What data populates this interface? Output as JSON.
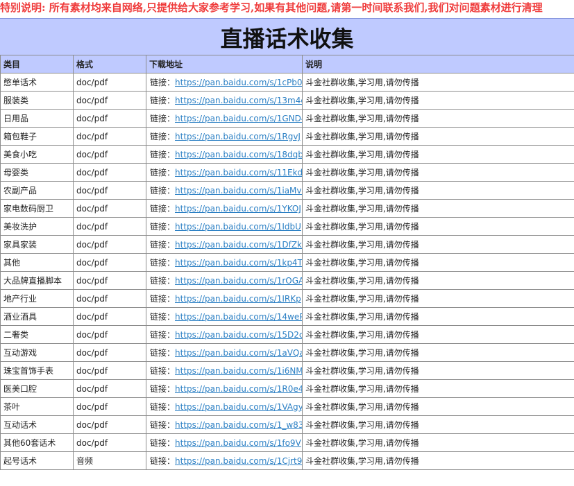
{
  "notice": "特别说明: 所有素材均来自网络,只提供给大家参考学习,如果有其他问题,请第一时间联系我们,我们对问题素材进行清理",
  "title": "直播话术收集",
  "columns": [
    "类目",
    "格式",
    "下载地址",
    "说明"
  ],
  "link_label": "链接：",
  "rows": [
    {
      "category": "憋单话术",
      "format": "doc/pdf",
      "url": "https://pan.baidu.com/s/1cPb0",
      "note": "斗金社群收集,学习用,请勿传播"
    },
    {
      "category": "服装类",
      "format": "doc/pdf",
      "url": "https://pan.baidu.com/s/13m4c",
      "note": "斗金社群收集,学习用,请勿传播"
    },
    {
      "category": "日用品",
      "format": "doc/pdf",
      "url": "https://pan.baidu.com/s/1GND4",
      "note": "斗金社群收集,学习用,请勿传播"
    },
    {
      "category": "箱包鞋子",
      "format": "doc/pdf",
      "url": "https://pan.baidu.com/s/1RgvJ",
      "note": "斗金社群收集,学习用,请勿传播"
    },
    {
      "category": "美食小吃",
      "format": "doc/pdf",
      "url": "https://pan.baidu.com/s/18dqb",
      "note": "斗金社群收集,学习用,请勿传播"
    },
    {
      "category": "母婴类",
      "format": "doc/pdf",
      "url": "https://pan.baidu.com/s/11Ekd",
      "note": "斗金社群收集,学习用,请勿传播"
    },
    {
      "category": "农副产品",
      "format": "doc/pdf",
      "url": "https://pan.baidu.com/s/1iaMvi",
      "note": "斗金社群收集,学习用,请勿传播"
    },
    {
      "category": "家电数码厨卫",
      "format": "doc/pdf",
      "url": "https://pan.baidu.com/s/1YKOJ",
      "note": "斗金社群收集,学习用,请勿传播"
    },
    {
      "category": "美妆洗护",
      "format": "doc/pdf",
      "url": "https://pan.baidu.com/s/1IdbU",
      "note": "斗金社群收集,学习用,请勿传播"
    },
    {
      "category": "家具家装",
      "format": "doc/pdf",
      "url": "https://pan.baidu.com/s/1DfZk",
      "note": "斗金社群收集,学习用,请勿传播"
    },
    {
      "category": "其他",
      "format": "doc/pdf",
      "url": "https://pan.baidu.com/s/1kp4T",
      "note": "斗金社群收集,学习用,请勿传播"
    },
    {
      "category": "大品牌直播脚本",
      "format": "doc/pdf",
      "url": "https://pan.baidu.com/s/1rOGA",
      "note": "斗金社群收集,学习用,请勿传播"
    },
    {
      "category": "地产行业",
      "format": "doc/pdf",
      "url": "https://pan.baidu.com/s/1IRKp",
      "note": "斗金社群收集,学习用,请勿传播"
    },
    {
      "category": "酒业酒具",
      "format": "doc/pdf",
      "url": "https://pan.baidu.com/s/14weP",
      "note": "斗金社群收集,学习用,请勿传播"
    },
    {
      "category": "二奢类",
      "format": "doc/pdf",
      "url": "https://pan.baidu.com/s/15D2c",
      "note": "斗金社群收集,学习用,请勿传播"
    },
    {
      "category": "互动游戏",
      "format": "doc/pdf",
      "url": "https://pan.baidu.com/s/1aVQa",
      "note": "斗金社群收集,学习用,请勿传播"
    },
    {
      "category": "珠宝首饰手表",
      "format": "doc/pdf",
      "url": "https://pan.baidu.com/s/1i6NM",
      "note": "斗金社群收集,学习用,请勿传播"
    },
    {
      "category": "医美口腔",
      "format": "doc/pdf",
      "url": "https://pan.baidu.com/s/1R0e4",
      "note": "斗金社群收集,学习用,请勿传播"
    },
    {
      "category": "茶叶",
      "format": "doc/pdf",
      "url": "https://pan.baidu.com/s/1VAgy",
      "note": "斗金社群收集,学习用,请勿传播"
    },
    {
      "category": "互动话术",
      "format": "doc/pdf",
      "url": "https://pan.baidu.com/s/1_w83",
      "note": "斗金社群收集,学习用,请勿传播"
    },
    {
      "category": "其他60套话术",
      "format": "doc/pdf",
      "url": "https://pan.baidu.com/s/1fo9V",
      "note": "斗金社群收集,学习用,请勿传播"
    },
    {
      "category": "起号话术",
      "format": "音频",
      "url": "https://pan.baidu.com/s/1Cjrt9",
      "note": "斗金社群收集,学习用,请勿传播"
    }
  ]
}
